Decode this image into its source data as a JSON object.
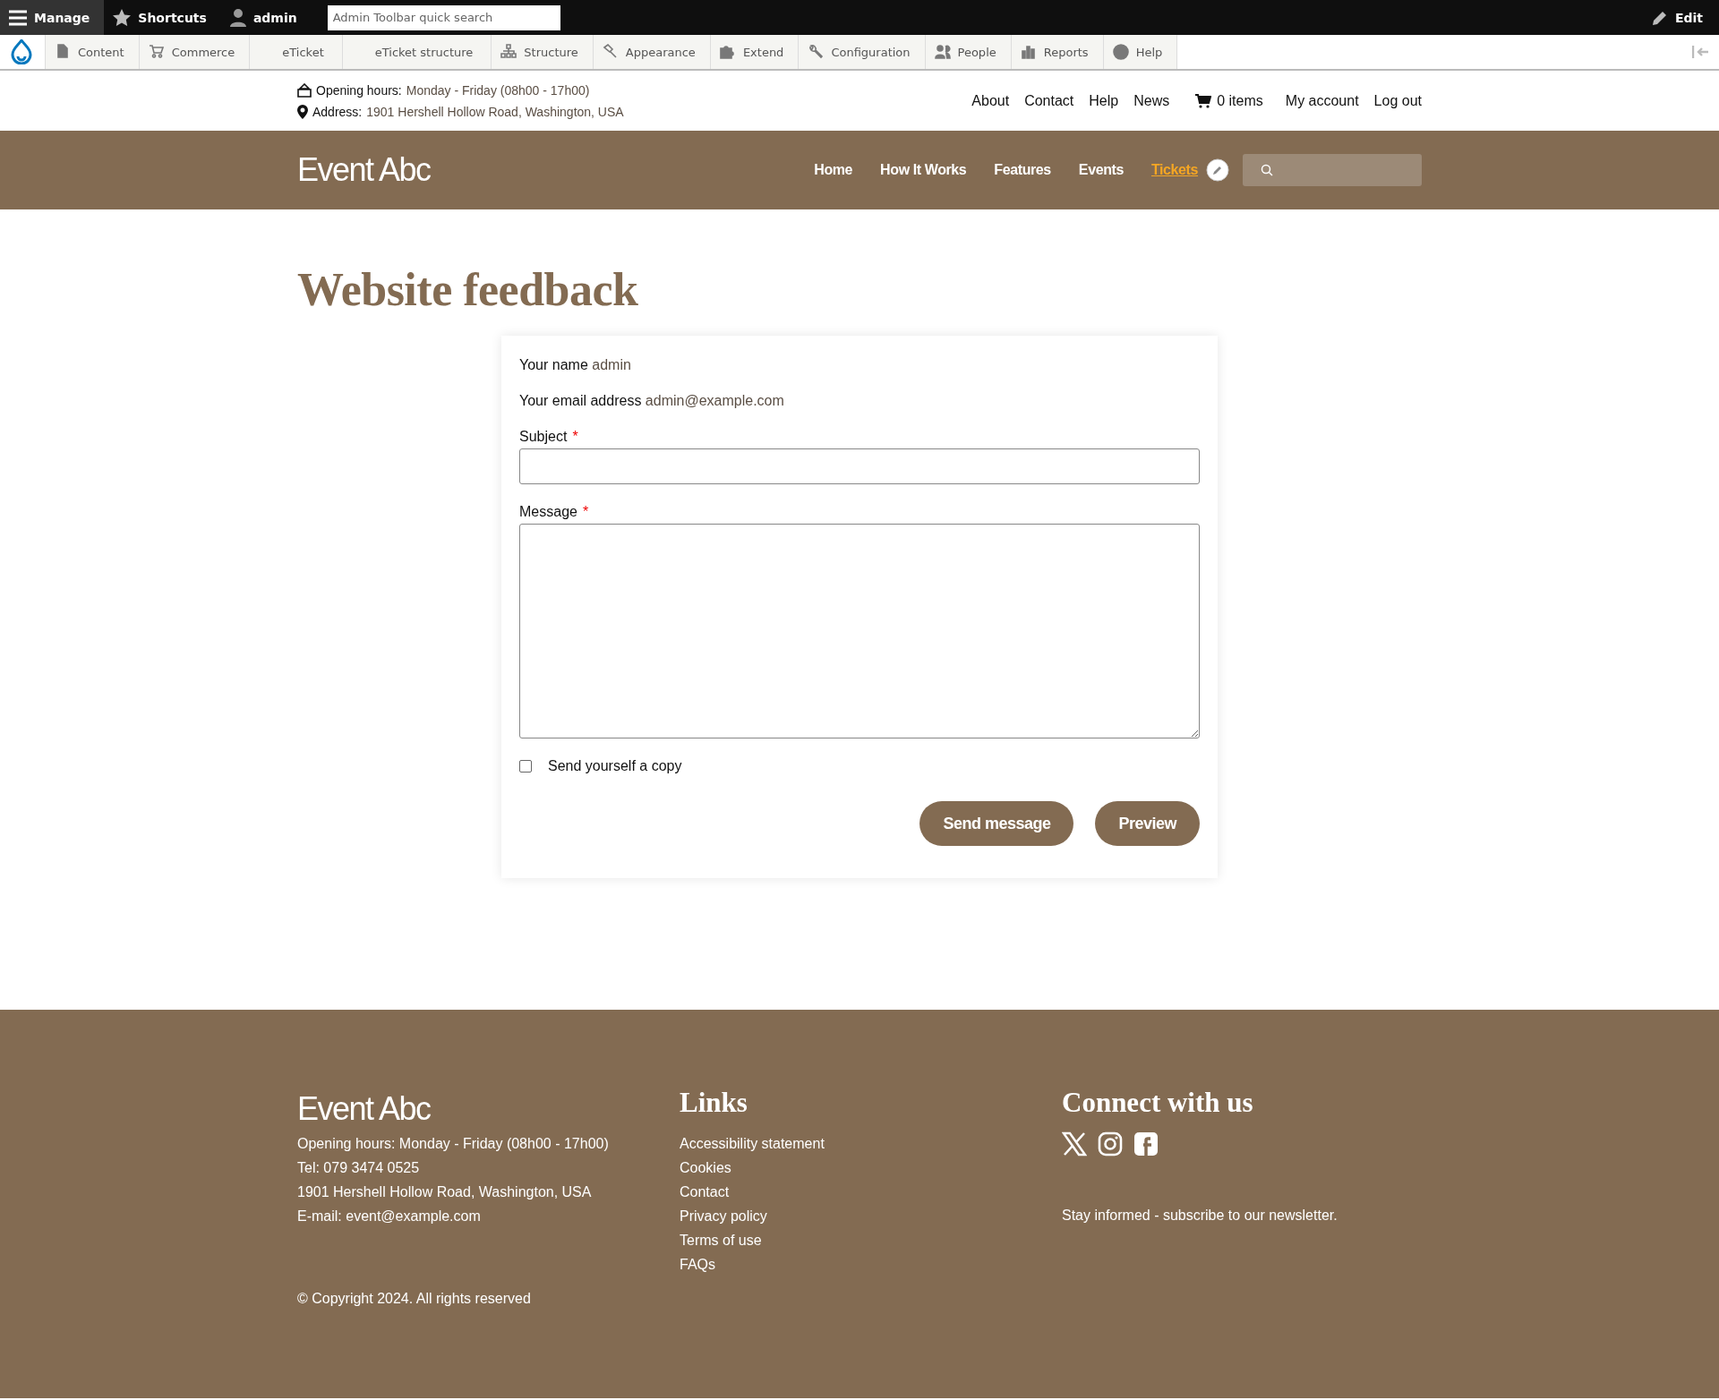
{
  "admin_toolbar": {
    "tabs": [
      {
        "label": "Manage",
        "selected": true
      },
      {
        "label": "Shortcuts",
        "selected": false
      },
      {
        "label": "admin",
        "selected": false
      }
    ],
    "search": {
      "placeholder": "Admin Toolbar quick search"
    },
    "edit": "Edit",
    "menu": [
      {
        "label": "Content"
      },
      {
        "label": "Commerce"
      },
      {
        "label": "eTicket"
      },
      {
        "label": "eTicket structure"
      },
      {
        "label": "Structure"
      },
      {
        "label": "Appearance"
      },
      {
        "label": "Extend"
      },
      {
        "label": "Configuration"
      },
      {
        "label": "People"
      },
      {
        "label": "Reports"
      },
      {
        "label": "Help"
      }
    ]
  },
  "info_bar": {
    "opening_label": "Opening hours:",
    "opening_value": "Monday - Friday (08h00 - 17h00)",
    "address_label": "Address:",
    "address_value": "1901 Hershell Hollow Road, Washington, USA",
    "links": [
      "About",
      "Contact",
      "Help",
      "News"
    ],
    "cart": "0 items",
    "account_links": [
      "My account",
      "Log out"
    ]
  },
  "header": {
    "logo": "Event Abc",
    "nav": [
      {
        "label": "Home",
        "selected": false
      },
      {
        "label": "How It Works",
        "selected": false
      },
      {
        "label": "Features",
        "selected": false
      },
      {
        "label": "Events",
        "selected": false
      },
      {
        "label": "Tickets",
        "selected": true
      }
    ]
  },
  "page_title": "Website feedback",
  "form": {
    "name_label": "Your name",
    "name_value": "admin",
    "email_label": "Your email address",
    "email_value": "admin@example.com",
    "subject_label": "Subject",
    "message_label": "Message",
    "required_mark": "*",
    "copy_checkbox": {
      "label": "Send yourself a copy",
      "checked": false
    },
    "buttons": [
      "Send message",
      "Preview"
    ]
  },
  "footer": {
    "logo": "Event Abc",
    "contact_lines": [
      "Opening hours: Monday - Friday (08h00 - 17h00)",
      "Tel: 079 3474 0525",
      "1901 Hershell Hollow Road, Washington, USA",
      "E-mail: event@example.com"
    ],
    "links_title": "Links",
    "links": [
      "Accessibility statement",
      "Cookies",
      "Contact",
      "Privacy policy",
      "Terms of use",
      "FAQs"
    ],
    "connect_title": "Connect with us",
    "newsletter": "Stay informed - subscribe to our newsletter.",
    "copyright": "© Copyright 2024. All rights reserved"
  }
}
